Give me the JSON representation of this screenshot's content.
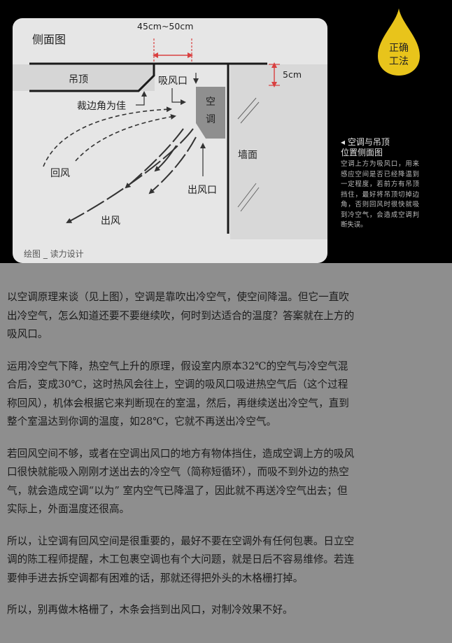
{
  "diagram": {
    "title": "侧面图",
    "dimension_top": "45cm~50cm",
    "dimension_side": "5cm",
    "ceiling_label": "吊顶",
    "air_intake_label": "吸风口",
    "chamfer_label": "裁边角为佳",
    "ac_label_1": "空",
    "ac_label_2": "调",
    "wall_label": "墙面",
    "return_air_label": "回风",
    "outlet_label": "出风口",
    "outflow_label": "出风",
    "credit": "绘图 _ 读力设计",
    "badge_line1": "正确",
    "badge_line2": "工法",
    "badge_color": "#e8c41b"
  },
  "caption": {
    "title_line1": "◂ 空调与吊顶",
    "title_line2": "位置侧面图",
    "text": "空调上方为吸风口，用来感应空间是否已经降温到一定程度，若前方有吊顶挡住，最好将吊顶切掉边角，否则回风时很快就吸到冷空气，会造成空调判断失误。"
  },
  "paragraphs": [
    "以空调原理来谈（见上图），空调是靠吹出冷空气，使空间降温。但它一直吹出冷空气，怎么知道还要不要继续吹，何时到达适合的温度？答案就在上方的吸风口。",
    "运用冷空气下降，热空气上升的原理，假设室内原本32℃的空气与冷空气混合后，变成30℃，这时热风会往上，空调的吸风口吸进热空气后（这个过程称回风），机体会根据它来判断现在的室温，然后，再继续送出冷空气，直到整个室温达到你调的温度，如28℃，它就不再送出冷空气。",
    "若回风空间不够，或者在空调出风口的地方有物体挡住，造成空调上方的吸风口很快就能吸入刚刚才送出去的冷空气（简称短循环），而吸不到外边的热空气，就会造成空调“以为” 室内空气已降温了，因此就不再送冷空气出去；但实际上，外面温度还很高。",
    "所以，让空调有回风空间是很重要的，最好不要在空调外有任何包裹。日立空调的陈工程师提醒，木工包裹空调也有个大问题，就是日后不容易维修。若连要伸手进去拆空调都有困难的话，那就还得把外头的木格栅打掉。",
    "所以，别再做木格栅了，木条会挡到出风口，对制冷效果不好。"
  ]
}
